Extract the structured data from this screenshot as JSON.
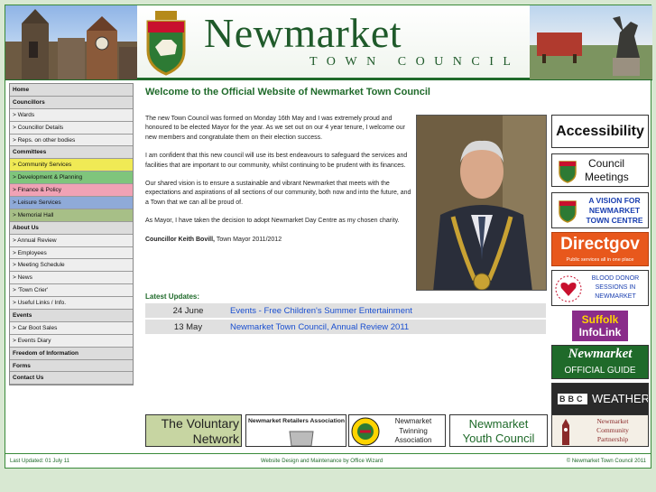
{
  "header": {
    "title": "Newmarket",
    "subtitle": "TOWN COUNCIL"
  },
  "nav": {
    "items": [
      {
        "label": "Home",
        "type": "head",
        "color": ""
      },
      {
        "label": "Councillors",
        "type": "head",
        "color": ""
      },
      {
        "label": "> Wards",
        "type": "link",
        "color": ""
      },
      {
        "label": "> Councillor Details",
        "type": "link",
        "color": ""
      },
      {
        "label": "> Reps. on other bodies",
        "type": "link",
        "color": ""
      },
      {
        "label": "Committees",
        "type": "head",
        "color": ""
      },
      {
        "label": "> Community Services",
        "type": "link",
        "color": "#f0ea55"
      },
      {
        "label": "> Development & Planning",
        "type": "link",
        "color": "#7fc57c"
      },
      {
        "label": "> Finance & Policy",
        "type": "link",
        "color": "#f0a2b5"
      },
      {
        "label": "> Leisure Services",
        "type": "link",
        "color": "#8faad8"
      },
      {
        "label": "> Memorial Hall",
        "type": "link",
        "color": "#a7bf87"
      },
      {
        "label": "About Us",
        "type": "head",
        "color": ""
      },
      {
        "label": "> Annual Review",
        "type": "link",
        "color": ""
      },
      {
        "label": "> Employees",
        "type": "link",
        "color": ""
      },
      {
        "label": "> Meeting Schedule",
        "type": "link",
        "color": ""
      },
      {
        "label": "> News",
        "type": "link",
        "color": ""
      },
      {
        "label": "> 'Town Crier'",
        "type": "link",
        "color": ""
      },
      {
        "label": "> Useful Links / Info.",
        "type": "link",
        "color": ""
      },
      {
        "label": "Events",
        "type": "head",
        "color": ""
      },
      {
        "label": "> Car Boot Sales",
        "type": "link",
        "color": ""
      },
      {
        "label": "> Events Diary",
        "type": "link",
        "color": ""
      },
      {
        "label": "Freedom of Information",
        "type": "head",
        "color": ""
      },
      {
        "label": "Forms",
        "type": "head",
        "color": ""
      },
      {
        "label": "Contact Us",
        "type": "head",
        "color": ""
      }
    ]
  },
  "main": {
    "welcome": "Welcome to the Official Website of Newmarket Town Council",
    "p1": "The new Town Council was formed on Monday 16th May and I was extremely proud and honoured to be elected Mayor for the year. As we set out on our 4 year tenure, I welcome our new members and congratulate them on their election success.",
    "p2": "I am confident that this new council will use its best endeavours to safeguard the services and facilities that are important to our community, whilst continuing to be prudent with its finances.",
    "p3": "Our shared vision is to ensure a sustainable and vibrant Newmarket that meets with the expectations and aspirations of all sections of our community, both now and into the future, and a Town that we can all be proud of.",
    "p4": "As Mayor, I have taken the decision to adopt Newmarket Day Centre as my chosen charity.",
    "signature_name": "Councillor Keith Bovill,",
    "signature_role": " Town Mayor 2011/2012",
    "latest_heading": "Latest Updates:",
    "updates": [
      {
        "date": "24 June",
        "title": "Events - Free Children's Summer Entertainment"
      },
      {
        "date": "13 May",
        "title": "Newmarket Town Council, Annual Review 2011"
      }
    ]
  },
  "right": {
    "accessibility": "Accessibility",
    "council_meetings_1": "Council",
    "council_meetings_2": "Meetings",
    "vision_1": "A VISION FOR",
    "vision_2": "NEWMARKET",
    "vision_3": "TOWN CENTRE",
    "directgov": "Directgov",
    "directgov_tag": "Public services all in one place",
    "blood_1": "BLOOD DONOR",
    "blood_2": "SESSIONS IN",
    "blood_3": "NEWMARKET",
    "suffolk_1": "Suffolk",
    "suffolk_2": "InfoLink",
    "guide_1": "Newmarket",
    "guide_2": "OFFICIAL GUIDE",
    "bbc": "BBC",
    "weather": "WEATHER"
  },
  "bottom": {
    "voluntary_1": "The Voluntary",
    "voluntary_2": "Network",
    "retailers": "Newmarket Retailers Association",
    "twinning_1": "Newmarket",
    "twinning_2": "Twinning",
    "twinning_3": "Association",
    "youth_1": "Newmarket",
    "youth_2": "Youth Council",
    "partnership_1": "Newmarket",
    "partnership_2": "Community",
    "partnership_3": "Partnership"
  },
  "footer": {
    "last_updated": "Last Updated: 01 July 11",
    "design": "Website Design and Maintenance by Office Wizard",
    "copyright": "© Newmarket Town Council 2011"
  },
  "colors": {
    "brand_green": "#1f6a2a",
    "link_blue": "#1a4fd0",
    "directgov_orange": "#e8581c",
    "suffolk_purple": "#8a2c8a"
  }
}
